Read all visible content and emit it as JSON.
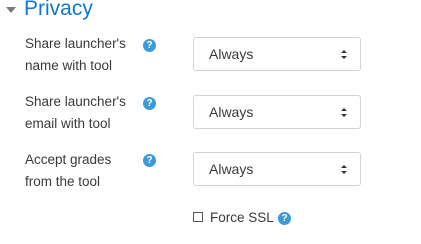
{
  "section": {
    "title": "Privacy"
  },
  "rows": [
    {
      "label_line1": "Share launcher's",
      "label_line2": "name with tool",
      "value": "Always"
    },
    {
      "label_line1": "Share launcher's",
      "label_line2": "email with tool",
      "value": "Always"
    },
    {
      "label_line1": "Accept grades",
      "label_line2": "from the tool",
      "value": "Always"
    }
  ],
  "force_ssl": {
    "label": "Force SSL",
    "checked": false
  },
  "help_glyph": "?",
  "colors": {
    "accent": "#1177d1",
    "help_icon": "#3d9ad8",
    "border": "#ced4da"
  }
}
